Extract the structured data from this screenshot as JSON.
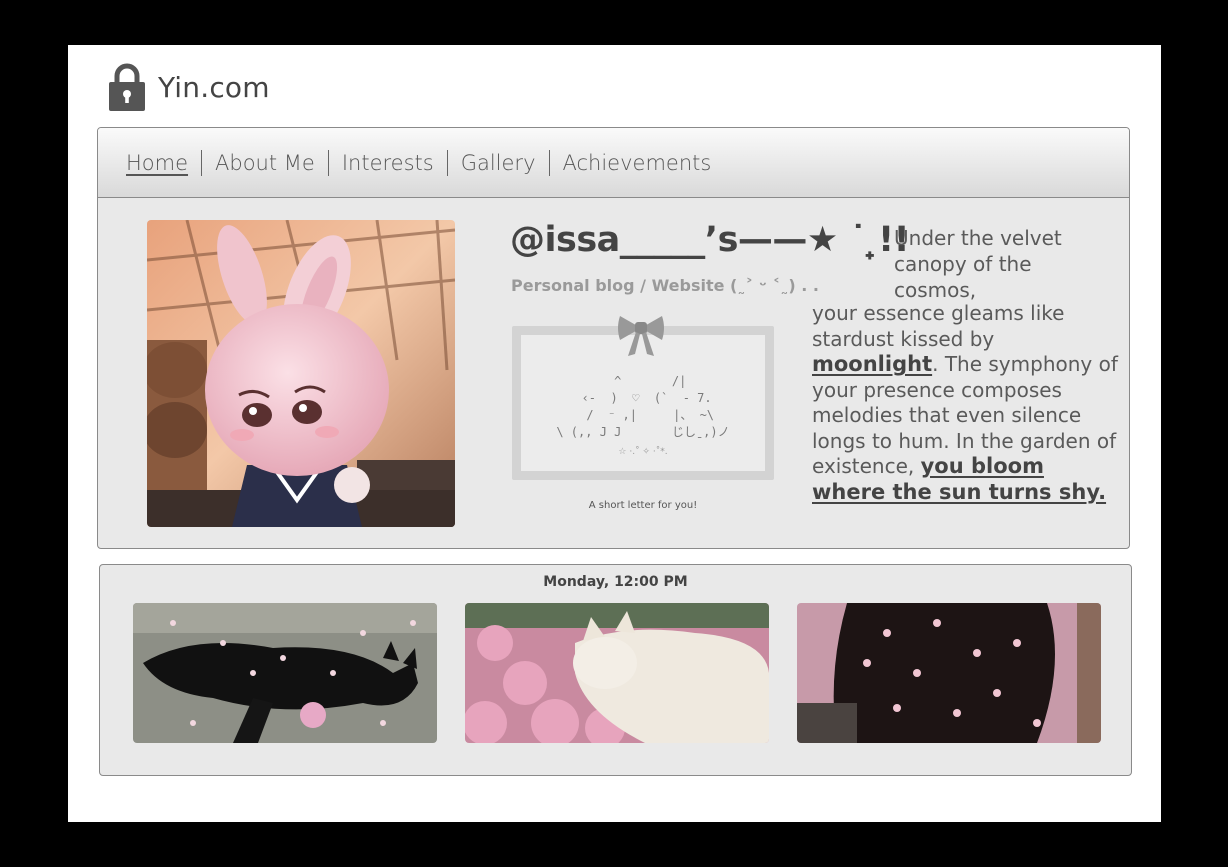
{
  "site": {
    "title": "Yin.com",
    "lock_icon": "lock-icon"
  },
  "nav": {
    "items": [
      {
        "label": "Home",
        "active": true
      },
      {
        "label": "About Me"
      },
      {
        "label": "Interests"
      },
      {
        "label": "Gallery"
      },
      {
        "label": "Achievements"
      }
    ]
  },
  "profile": {
    "handle": "@issa_____’s——★ ˙ ̟!!",
    "subtitle": "Personal blog / Website (˷˃ ᵕ ˂˷) . .",
    "letter_art": "  ^       /|\n ‹-  )  ♡  (`  - 7.\n  /  ⁻ ,|     |、 ~\\\n\\ (,, J J       じしˍ,)ノ",
    "letter_stars": "☆ ·.˚ ✧ ·˚*.",
    "letter_caption": "A short letter for you!"
  },
  "poem": {
    "lead": "Under the velvet canopy of the cosmos,",
    "line1": "your essence gleams like stardust kissed by ",
    "hl1": "moonlight",
    "line2": ". The symphony of your presence composes melodies that even silence longs to hum. In the garden of existence, ",
    "hl2": "you bloom where the sun turns shy."
  },
  "gallery": {
    "timestamp": "Monday, 12:00 PM"
  },
  "colors": {
    "page_bg": "#ffffff",
    "panel_bg": "#e9e9e9",
    "border": "#8a8a8a",
    "text": "#555555"
  }
}
